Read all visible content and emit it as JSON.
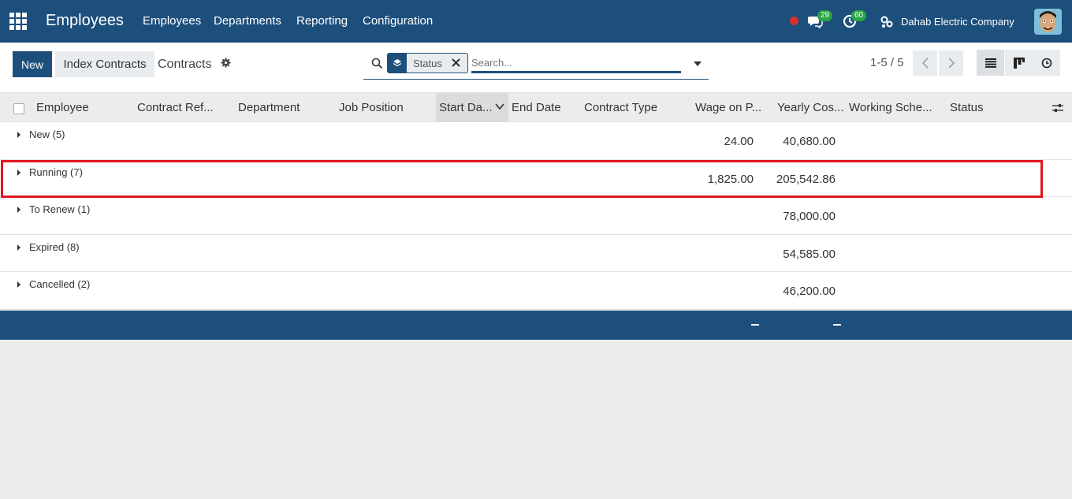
{
  "navbar": {
    "app_title": "Employees",
    "menu": [
      "Employees",
      "Departments",
      "Reporting",
      "Configuration"
    ],
    "messages_count": "29",
    "activities_count": "60",
    "company": "Dahab Electric Company"
  },
  "control": {
    "new_label": "New",
    "index_label": "Index Contracts",
    "breadcrumb": "Contracts",
    "facet_label": "Status",
    "search_placeholder": "Search...",
    "pager": "1-5 / 5"
  },
  "table": {
    "columns": [
      "Employee",
      "Contract Ref...",
      "Department",
      "Job Position",
      "Start Da...",
      "End Date",
      "Contract Type",
      "Wage on P...",
      "Yearly Cos...",
      "Working Sche...",
      "Status"
    ],
    "groups": [
      {
        "label": "New (5)",
        "wage": "24.00",
        "yearly": "40,680.00"
      },
      {
        "label": "Running (7)",
        "wage": "1,825.00",
        "yearly": "205,542.86"
      },
      {
        "label": "To Renew (1)",
        "wage": "",
        "yearly": "78,000.00"
      },
      {
        "label": "Expired (8)",
        "wage": "",
        "yearly": "54,585.00"
      },
      {
        "label": "Cancelled (2)",
        "wage": "",
        "yearly": "46,200.00"
      }
    ]
  },
  "colors": {
    "brand": "#1d4f7c",
    "badge": "#2aa545",
    "highlight": "#e0161d"
  }
}
